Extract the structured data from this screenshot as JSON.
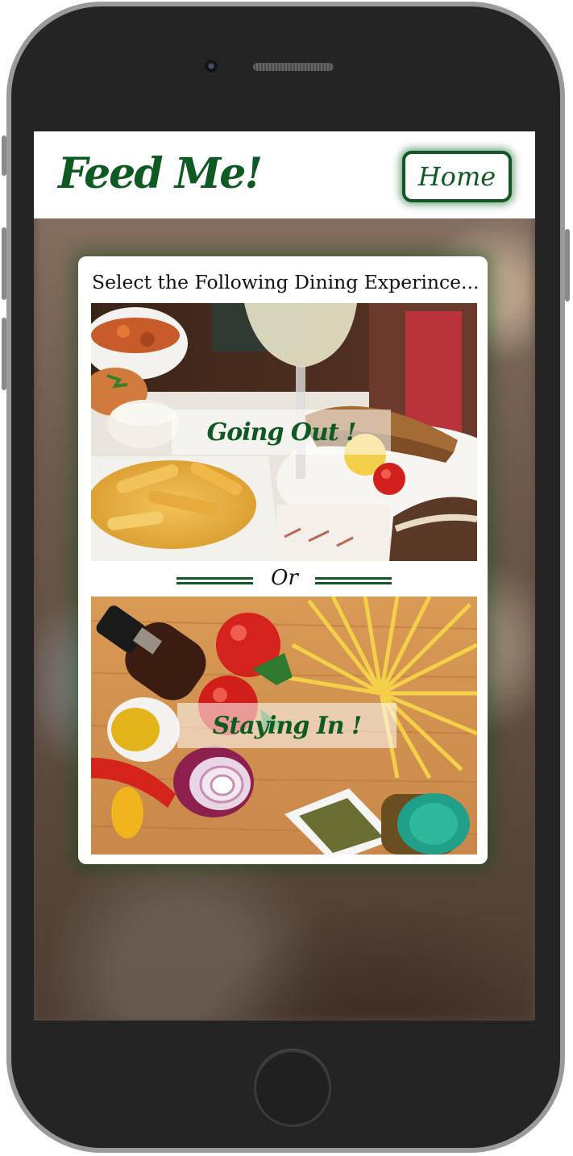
{
  "app": {
    "brand": "Feed Me!",
    "nav": {
      "home_label": "Home"
    }
  },
  "main": {
    "heading": "Select the Following Dining Experince...",
    "options": [
      {
        "label": "Going Out !"
      },
      {
        "label": "Staying In !"
      }
    ],
    "separator": "Or"
  },
  "colors": {
    "brand_green": "#0f5a23",
    "card_bg": "#ffffff",
    "device_body": "#242424"
  },
  "icons": {
    "device_camera": "camera-icon",
    "device_home": "home-button-icon"
  }
}
